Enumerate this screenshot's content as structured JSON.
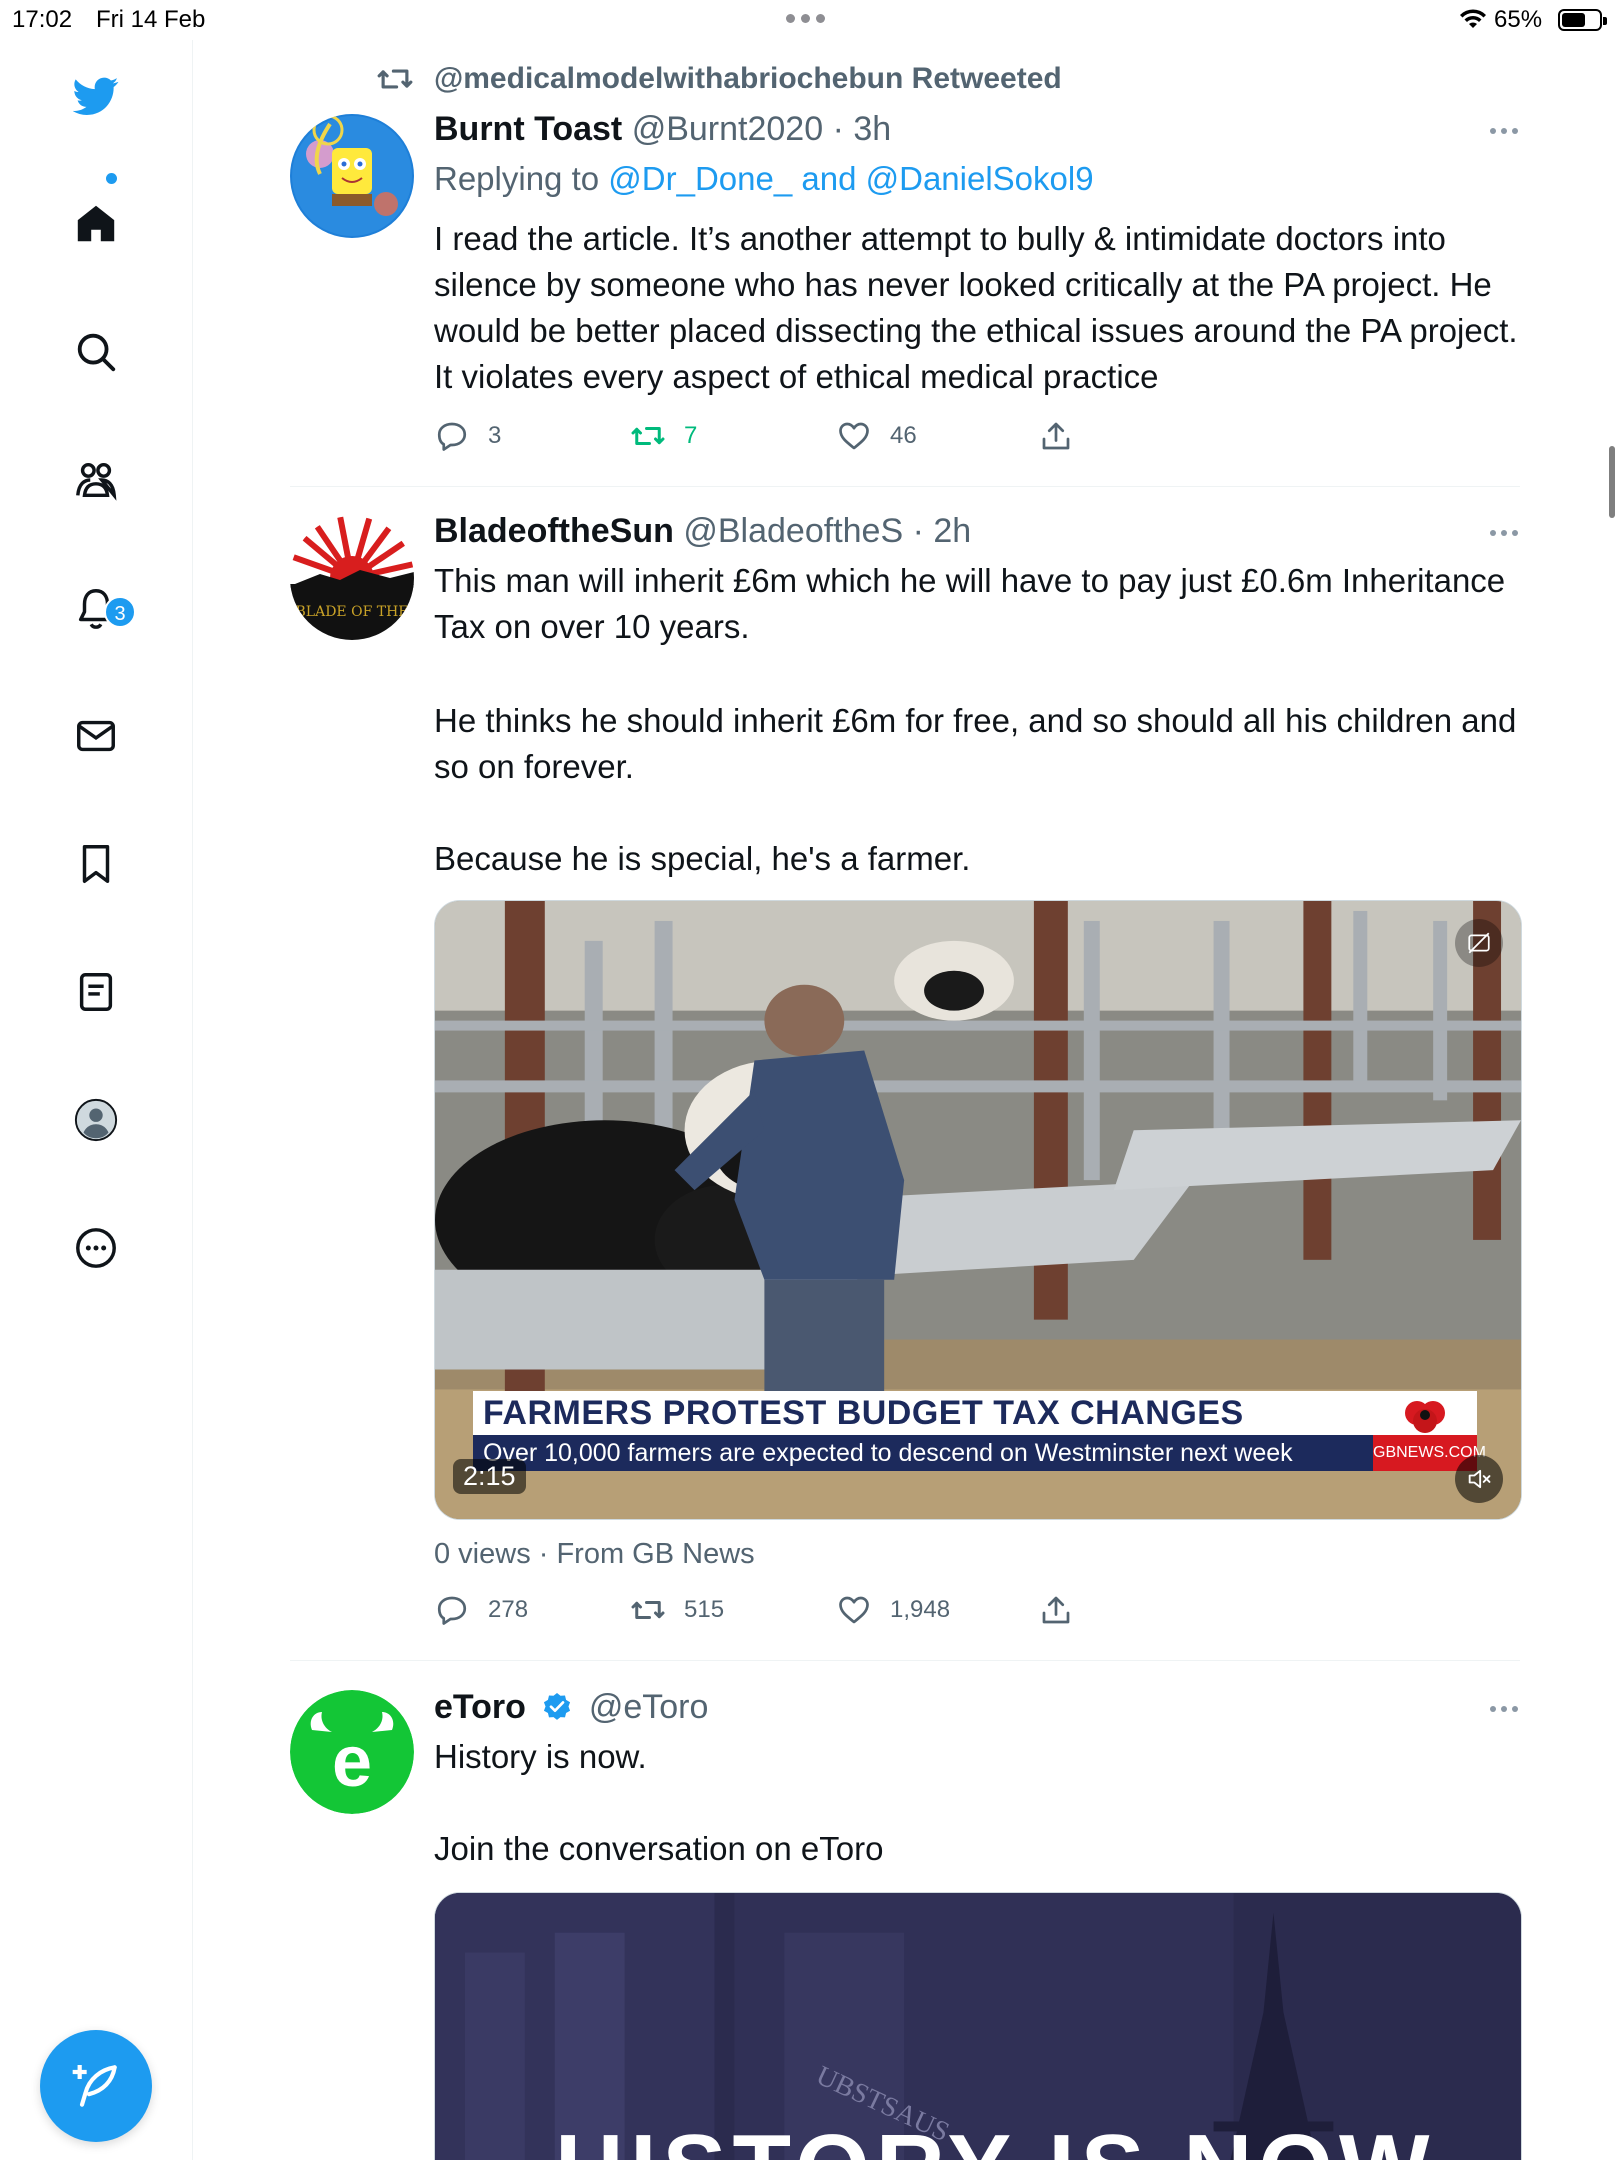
{
  "status_bar": {
    "time": "17:02",
    "date": "Fri 14 Feb",
    "battery_text": "65%",
    "battery_level": 0.65
  },
  "sidebar": {
    "notifications_badge": "3",
    "items": [
      "twitter-logo-icon",
      "home-icon",
      "search-icon",
      "communities-icon",
      "notifications-icon",
      "messages-icon",
      "bookmarks-icon",
      "lists-icon",
      "profile-icon",
      "more-icon"
    ],
    "compose_icon": "compose-icon",
    "accent": "#1d9bf0"
  },
  "tweets": [
    {
      "retweeted_by": "@medicalmodelwithabriochebun Retweeted",
      "name": "Burnt Toast",
      "handle": "@Burnt2020 · 3h",
      "replying_prefix": "Replying to",
      "replying_to_1": "@Dr_Done_",
      "replying_and": "and",
      "replying_to_2": "@DanielSokol9",
      "text": "I read the article. It’s another attempt to bully & intimidate doctors into silence by someone who has never looked critically at the PA project. He would be better placed dissecting the ethical issues around the PA project. It violates every aspect of ethical medical practice",
      "replies": "3",
      "retweets": "7",
      "likes": "46"
    },
    {
      "name": "BladeoftheSun",
      "handle": "@BladeoftheS · 2h",
      "text_1": "This man will inherit £6m which he will have to pay just £0.6m Inheritance Tax on over 10 years.",
      "text_2": "He thinks he should inherit £6m for free, and so should all his children and so on forever.",
      "text_3": "Because he is special, he's a farmer.",
      "avatar_text": "BLADE OF THE",
      "video": {
        "headline": "FARMERS PROTEST BUDGET TAX CHANGES",
        "subline": "Over 10,000 farmers are expected to descend on Westminster next week",
        "source_badge": "GBNEWS.COM",
        "duration": "2:15"
      },
      "views": "0 views · From GB News",
      "replies": "278",
      "retweets": "515",
      "likes": "1,948"
    },
    {
      "name": "eToro",
      "handle": "@eToro",
      "text_1": "History is now.",
      "text_2": "Join the conversation on eToro",
      "media_headline": "HISTORY IS NOW",
      "media_sign": "UBSTSAUS",
      "brand_color": "#13c636"
    }
  ]
}
